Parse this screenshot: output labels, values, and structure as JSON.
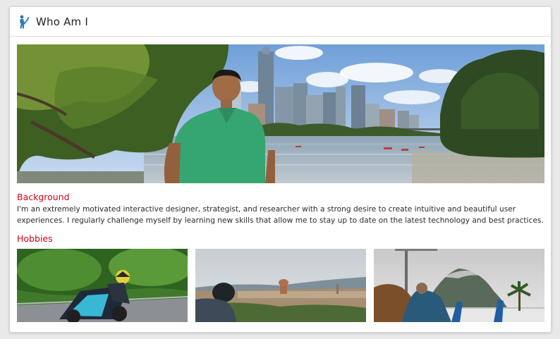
{
  "header": {
    "title": "Who Am I",
    "icon": "person-waving-icon"
  },
  "sections": {
    "background": {
      "title": "Background",
      "text": "I'm an extremely motivated interactive designer, strategist, and researcher with a strong desire to create intuitive and beautiful user experiences. I regularly challenge myself by learning new skills that allow me to stay up to date on the latest technology and best practices."
    },
    "hobbies": {
      "title": "Hobbies"
    }
  },
  "colors": {
    "accent": "#d0021b",
    "icon": "#2b7bb9"
  }
}
